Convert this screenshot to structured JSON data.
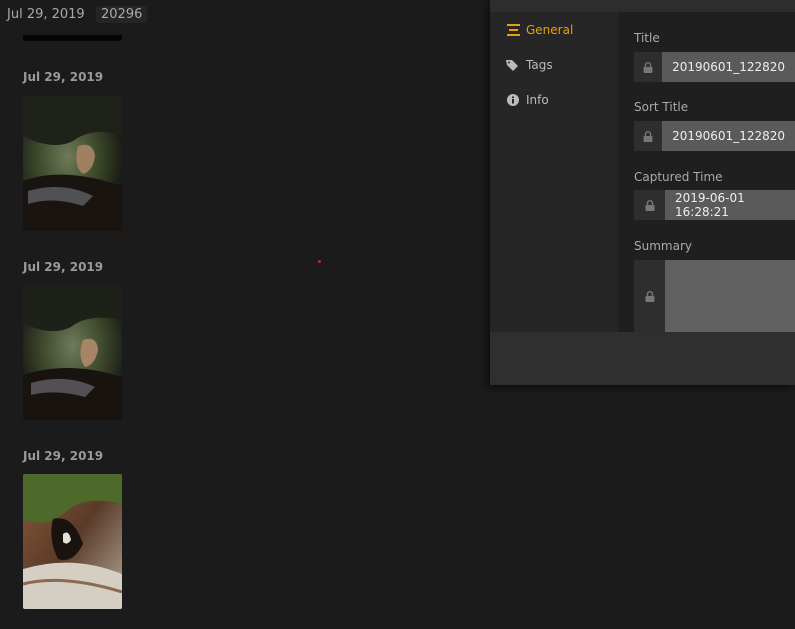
{
  "topbar": {
    "date": "Jul 29, 2019",
    "count": "20296"
  },
  "groups": [
    {
      "date": "Jul 29, 2019"
    },
    {
      "date": "Jul 29, 2019"
    },
    {
      "date": "Jul 29, 2019"
    }
  ],
  "modal": {
    "nav": [
      {
        "label": "General",
        "icon": "general-icon",
        "active": true
      },
      {
        "label": "Tags",
        "icon": "tag-icon",
        "active": false
      },
      {
        "label": "Info",
        "icon": "info-icon",
        "active": false
      }
    ],
    "fields": {
      "title": {
        "label": "Title",
        "value": "20190601_122820"
      },
      "sort_title": {
        "label": "Sort Title",
        "value": "20190601_122820"
      },
      "captured_time": {
        "label": "Captured Time",
        "value": "2019-06-01 16:28:21"
      },
      "summary": {
        "label": "Summary",
        "value": ""
      }
    }
  },
  "colors": {
    "accent": "#e5a00d",
    "background": "#1b1b1b",
    "panel": "#222222"
  }
}
